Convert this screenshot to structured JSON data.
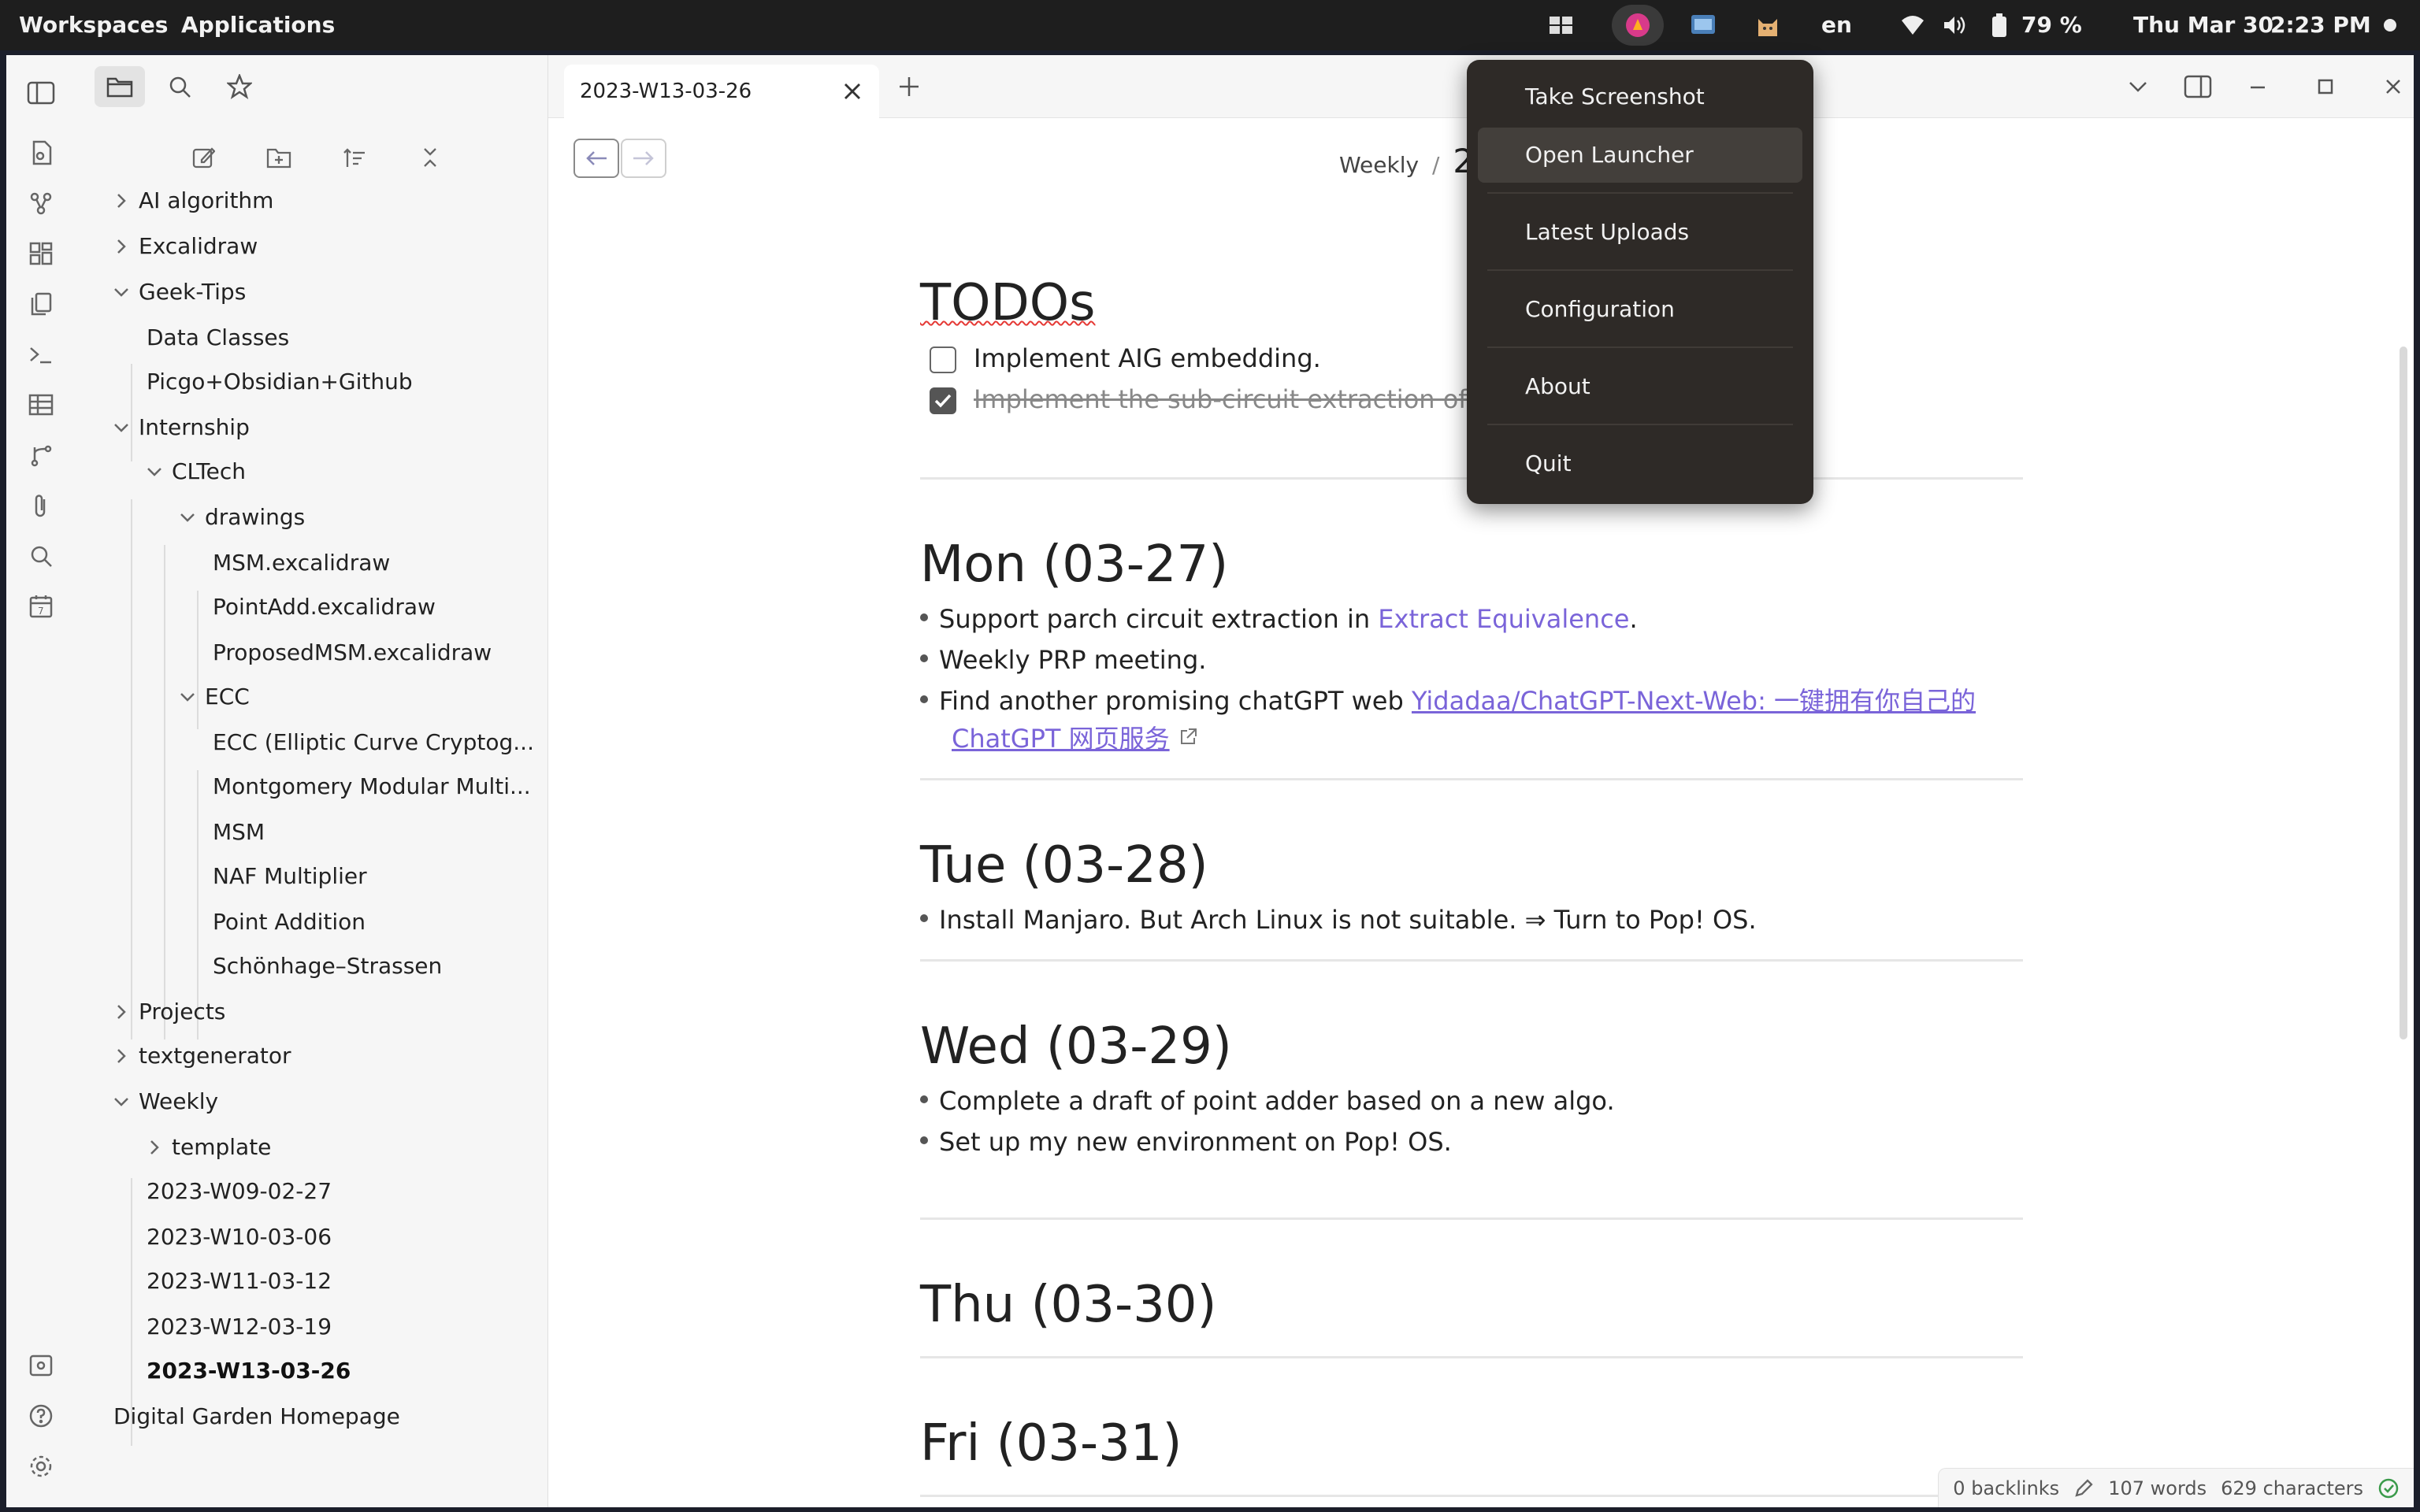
{
  "topbar": {
    "workspaces": "Workspaces",
    "applications": "Applications",
    "keyboard_layout": "en",
    "battery": "79 %",
    "date": "Thu Mar 30",
    "time": "2:23 PM"
  },
  "sidebar": {
    "tree": [
      {
        "label": "AI algorithm"
      },
      {
        "label": "Excalidraw"
      },
      {
        "label": "Geek-Tips"
      },
      {
        "label": "Data Classes"
      },
      {
        "label": "Picgo+Obsidian+Github"
      },
      {
        "label": "Internship"
      },
      {
        "label": "CLTech"
      },
      {
        "label": "drawings"
      },
      {
        "label": "MSM.excalidraw"
      },
      {
        "label": "PointAdd.excalidraw"
      },
      {
        "label": "ProposedMSM.excalidraw"
      },
      {
        "label": "ECC"
      },
      {
        "label": "ECC (Elliptic Curve Cryptog..."
      },
      {
        "label": "Montgomery Modular Multi..."
      },
      {
        "label": "MSM"
      },
      {
        "label": "NAF Multiplier"
      },
      {
        "label": "Point Addition"
      },
      {
        "label": "Schönhage–Strassen"
      },
      {
        "label": "Projects"
      },
      {
        "label": "textgenerator"
      },
      {
        "label": "Weekly"
      },
      {
        "label": "template"
      },
      {
        "label": "2023-W09-02-27"
      },
      {
        "label": "2023-W10-03-06"
      },
      {
        "label": "2023-W11-03-12"
      },
      {
        "label": "2023-W12-03-19"
      },
      {
        "label": "2023-W13-03-26"
      },
      {
        "label": "Digital Garden Homepage"
      }
    ]
  },
  "tab": {
    "title": "2023-W13-03-26"
  },
  "breadcrumb": {
    "folder": "Weekly",
    "sep": "/",
    "title_partial": "20"
  },
  "note": {
    "todos_heading": "TODOs",
    "todo1": "Implement AIG embedding.",
    "todo2": "Implement the sub-circuit extraction of pa",
    "mon_heading": "Mon (03-27)",
    "mon1_pre": "Support parch circuit extraction in ",
    "mon1_link": "Extract Equivalence",
    "mon1_post": ".",
    "mon2": "Weekly PRP meeting.",
    "mon3_pre": "Find another promising chatGPT web ",
    "mon3_link_a": "Yidadaa/ChatGPT-Next-Web: 一键拥有你自己的",
    "mon3_link_b": "ChatGPT 网页服务",
    "tue_heading": "Tue (03-28)",
    "tue1": "Install Manjaro. But Arch Linux is not suitable. ⇒ Turn to Pop! OS.",
    "wed_heading": "Wed (03-29)",
    "wed1": "Complete a draft of point adder based on a new algo.",
    "wed2": "Set up my new environment on Pop! OS.",
    "thu_heading": "Thu (03-30)",
    "fri_heading": "Fri (03-31)"
  },
  "status": {
    "backlinks": "0 backlinks",
    "words": "107 words",
    "chars": "629 characters"
  },
  "menu": {
    "take_screenshot": "Take Screenshot",
    "open_launcher": "Open Launcher",
    "latest_uploads": "Latest Uploads",
    "configuration": "Configuration",
    "about": "About",
    "quit": "Quit"
  },
  "colors": {
    "accent": "#7a64d9",
    "topbar": "#1e1e1e",
    "menu_bg": "#2e2a27"
  }
}
